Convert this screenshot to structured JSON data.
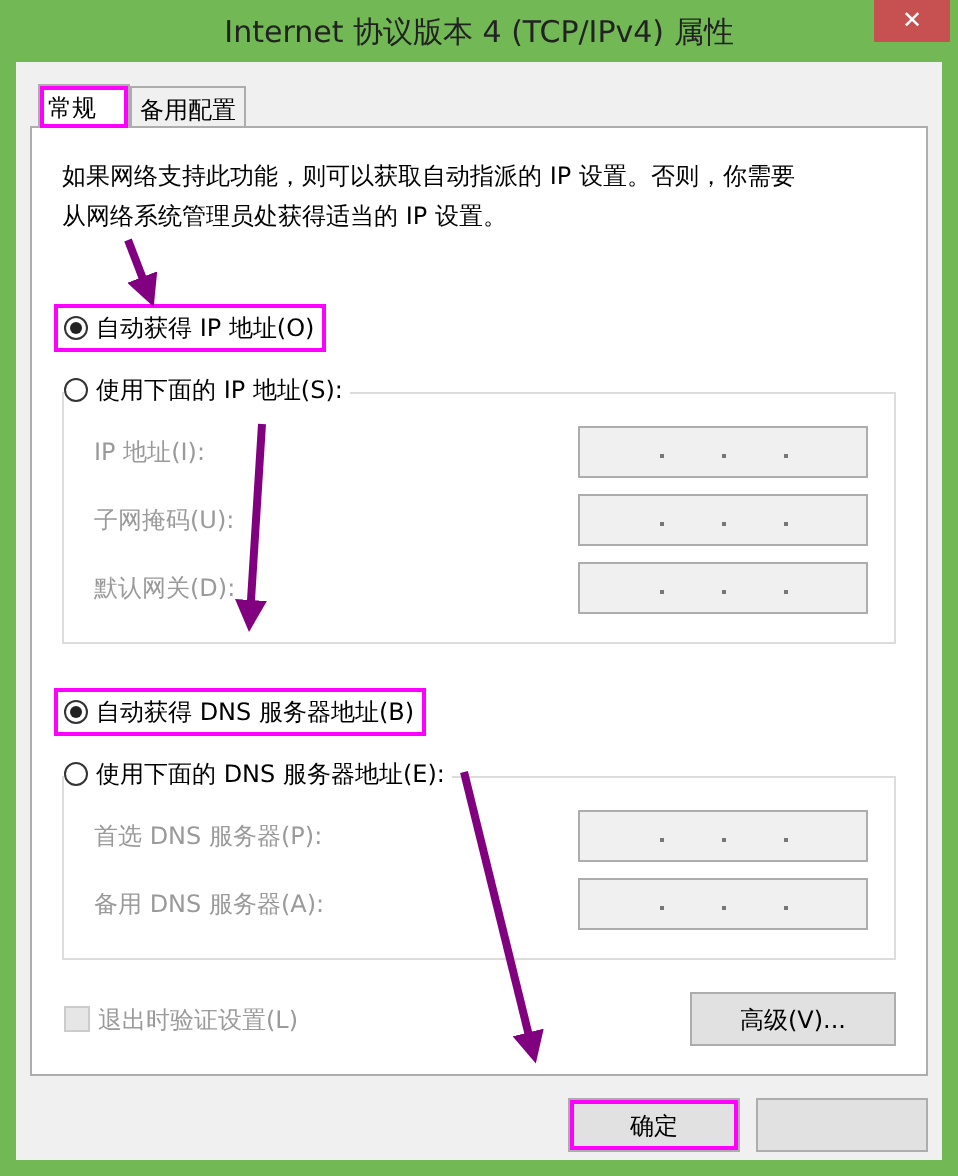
{
  "window": {
    "title": "Internet 协议版本 4 (TCP/IPv4) 属性",
    "close": "✕"
  },
  "tabs": [
    {
      "label": "常规",
      "selected": true,
      "highlighted": true
    },
    {
      "label": "备用配置",
      "selected": false,
      "highlighted": false
    }
  ],
  "description": "如果网络支持此功能，则可以获取自动指派的 IP 设置。否则，你需要从网络系统管理员处获得适当的 IP 设置。",
  "sections": [
    {
      "auto": {
        "label": "自动获得 IP 地址(O)",
        "selected": true,
        "highlighted": true
      },
      "manual": {
        "label": "使用下面的 IP 地址(S):",
        "selected": false
      },
      "fields": [
        {
          "label": "IP 地址(I):",
          "disabled": true
        },
        {
          "label": "子网掩码(U):",
          "disabled": true
        },
        {
          "label": "默认网关(D):",
          "disabled": true
        }
      ]
    },
    {
      "auto": {
        "label": "自动获得 DNS 服务器地址(B)",
        "selected": true,
        "highlighted": true
      },
      "manual": {
        "label": "使用下面的 DNS 服务器地址(E):",
        "selected": false
      },
      "fields": [
        {
          "label": "首选 DNS 服务器(P):",
          "disabled": true
        },
        {
          "label": "备用 DNS 服务器(A):",
          "disabled": true
        }
      ]
    }
  ],
  "validate": {
    "label": "退出时验证设置(L)",
    "checked": false,
    "disabled": true
  },
  "advanced_button": "高级(V)...",
  "buttons": [
    {
      "label": "确定",
      "highlighted": true
    },
    {
      "highlighted": false
    }
  ]
}
